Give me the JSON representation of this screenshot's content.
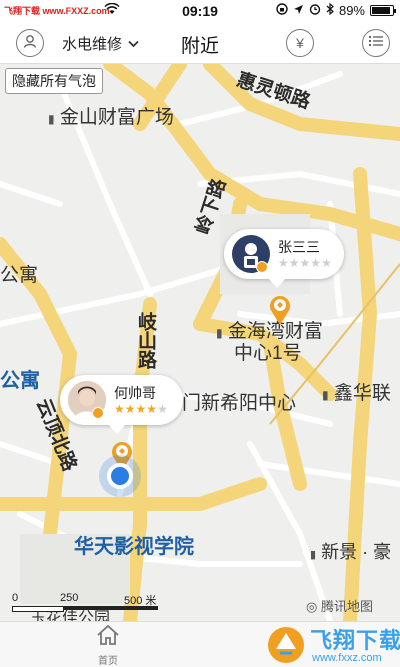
{
  "status_bar": {
    "watermark": "飞翔下载 www.FXXZ.com",
    "time": "09:19",
    "battery": "89%",
    "battery_level": 0.89
  },
  "nav": {
    "category": "水电维修",
    "title": "附近",
    "yen_symbol": "¥"
  },
  "map": {
    "hide_bubbles_label": "隐藏所有气泡",
    "labels": {
      "huiling_road": "惠灵顿路",
      "jinshan_plaza": "金山财富广场",
      "lingxia_road": "岭下路",
      "gongyu_1": "公寓",
      "qishan_road": "岐山路",
      "jinhaiwan": "金海湾财富",
      "jinhaiwan_2": "中心1号",
      "gongyu_2": "公寓",
      "xinxiyang": "门新希阳中心",
      "xinhua": "鑫华联",
      "yunding_road": "云顶北路",
      "huatian": "华天影视学院",
      "xinjing": "新景 · 豪",
      "jiuhua": "玉花佳公园",
      "tencent": "腾讯地图"
    },
    "workers": [
      {
        "name": "张三三",
        "rating": 0,
        "max_rating": 5
      },
      {
        "name": "何帅哥",
        "rating": 4,
        "max_rating": 5
      }
    ],
    "scale": {
      "zero": "0",
      "mid": "250",
      "end": "500 米"
    }
  },
  "tabbar": {
    "home_label": "首页",
    "watermark_big": "飞翔下载",
    "watermark_small": "www.fxxz.com"
  }
}
